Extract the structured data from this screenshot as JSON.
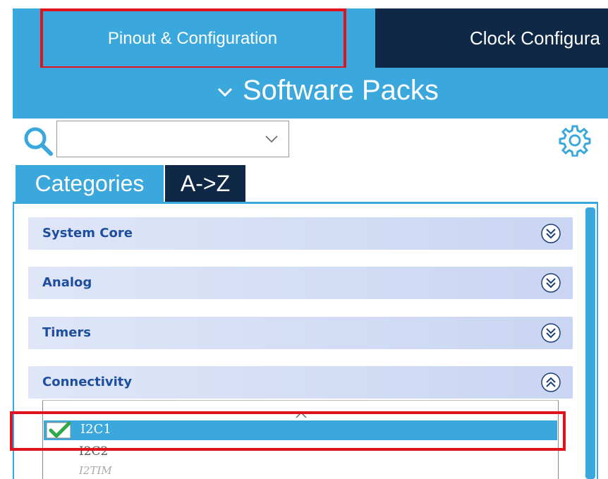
{
  "top_tabs": {
    "pinout": "Pinout & Configuration",
    "clock": "Clock Configura"
  },
  "software_packs": {
    "label": "Software Packs"
  },
  "search": {
    "value": "",
    "placeholder": ""
  },
  "category_tabs": {
    "categories": "Categories",
    "az": "A->Z"
  },
  "groups": [
    {
      "label": "System Core",
      "state": "collapsed"
    },
    {
      "label": "Analog",
      "state": "collapsed"
    },
    {
      "label": "Timers",
      "state": "collapsed"
    },
    {
      "label": "Connectivity",
      "state": "expanded"
    }
  ],
  "connectivity_items": [
    {
      "label": "I2C1",
      "selected": true,
      "enabled": true
    },
    {
      "label": "I2C2"
    },
    {
      "label": "I2TIM"
    }
  ],
  "colors": {
    "accent": "#3aa8dc",
    "dark": "#0f2846",
    "highlight": "#e0121b",
    "group_text": "#1d4f9e",
    "check": "#2ea84a"
  },
  "icons": {
    "search": "search-icon",
    "gear": "gear-icon",
    "dropdown": "chevron-down-icon",
    "expand": "expand-icon",
    "collapse": "collapse-icon",
    "check": "check-icon"
  }
}
